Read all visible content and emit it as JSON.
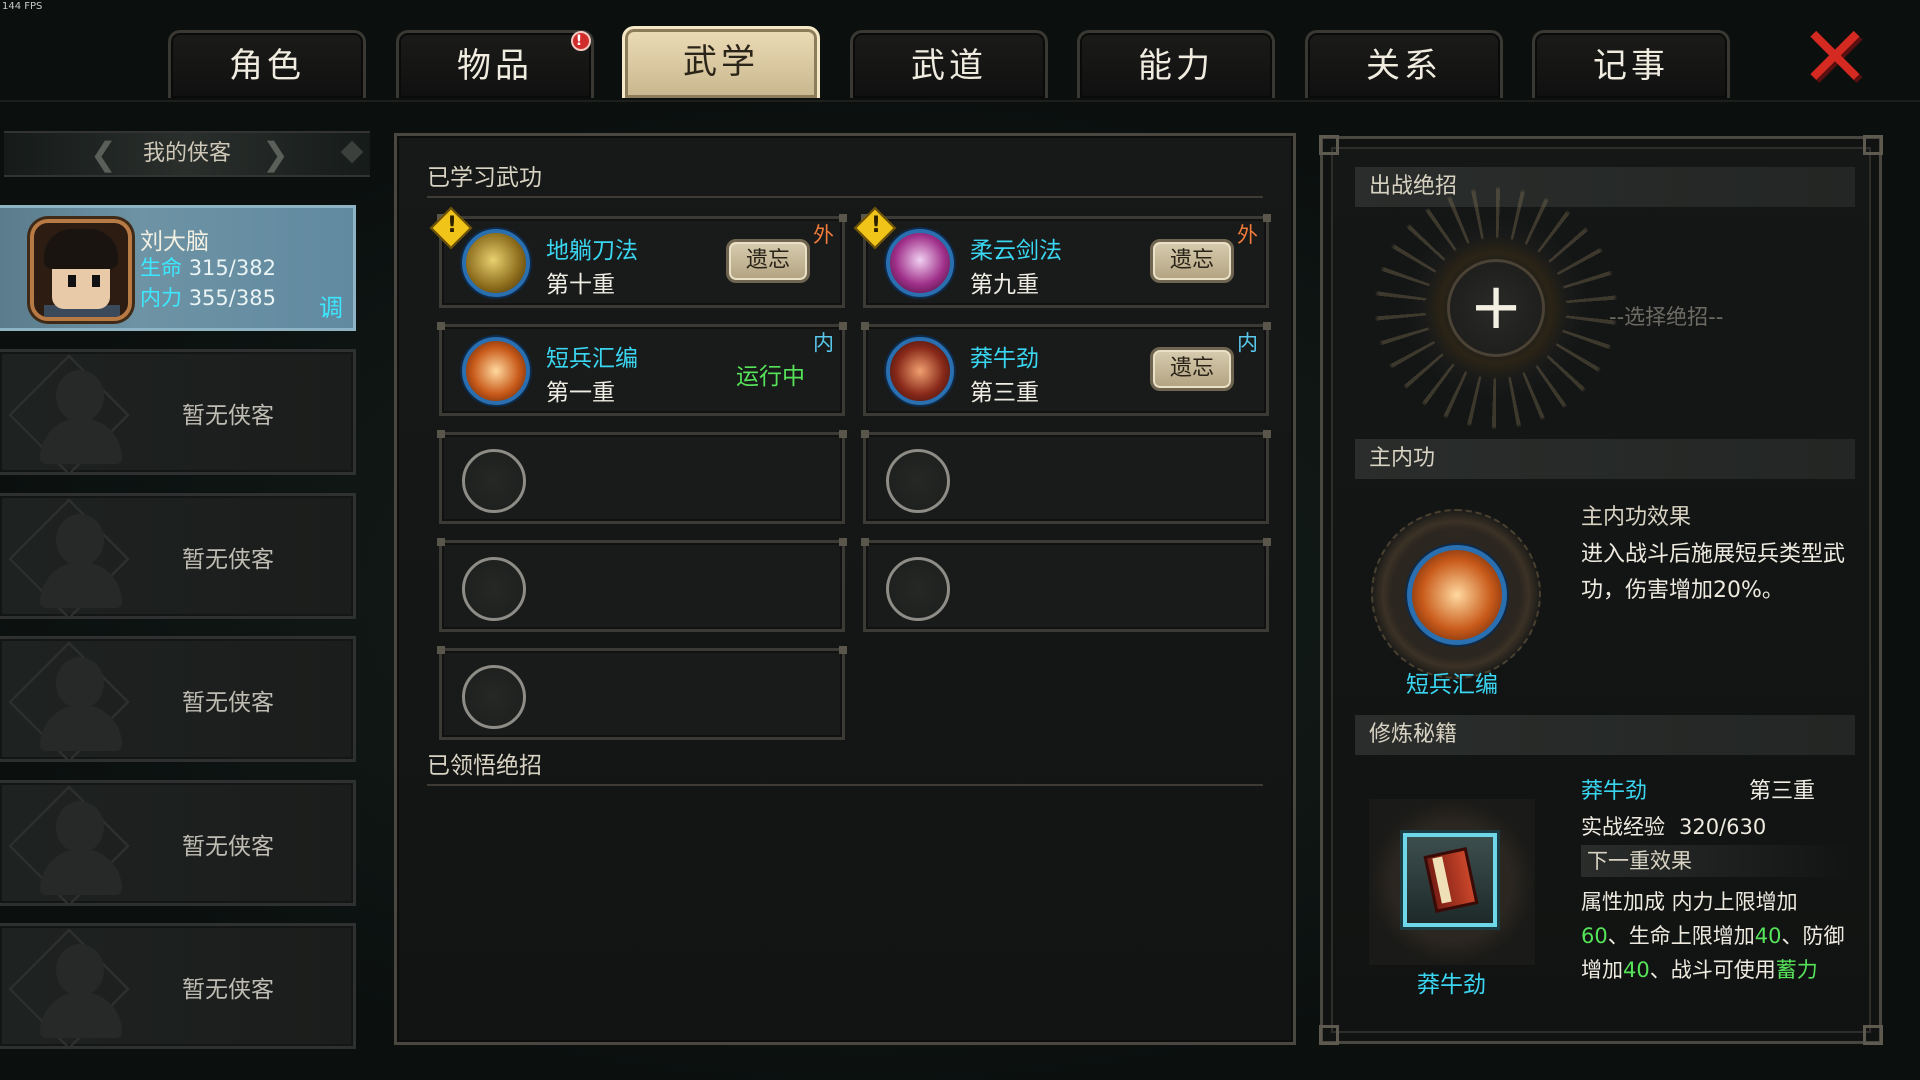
{
  "fps": "144 FPS",
  "tabs": [
    {
      "label": "角色"
    },
    {
      "label": "物品",
      "badge": "!"
    },
    {
      "label": "武学"
    },
    {
      "label": "武道"
    },
    {
      "label": "能力"
    },
    {
      "label": "关系"
    },
    {
      "label": "记事"
    }
  ],
  "active_tab": "武学",
  "roster": {
    "title": "我的侠客",
    "hero": {
      "name": "刘大脑",
      "hp_label": "生命",
      "hp": "315/382",
      "mp_label": "内力",
      "mp": "355/385",
      "tag": "调"
    },
    "empty_label": "暂无侠客"
  },
  "learned": {
    "title": "已学习武功",
    "skills": [
      {
        "name": "地躺刀法",
        "level": "第十重",
        "action": "遗忘",
        "type": "外",
        "warn": true
      },
      {
        "name": "柔云剑法",
        "level": "第九重",
        "action": "遗忘",
        "type": "外",
        "warn": true
      },
      {
        "name": "短兵汇编",
        "level": "第一重",
        "status": "运行中",
        "type": "内"
      },
      {
        "name": "莽牛劲",
        "level": "第三重",
        "action": "遗忘",
        "type": "内"
      }
    ]
  },
  "ultimates": {
    "title": "已领悟绝招"
  },
  "right": {
    "battle_ult": {
      "title": "出战绝招",
      "choose": "--选择绝招--"
    },
    "main_inner": {
      "title": "主内功",
      "skill_name": "短兵汇编",
      "effect_title": "主内功效果",
      "effect_text": "进入战斗后施展短兵类型武功，伤害增加20%。"
    },
    "training": {
      "title": "修炼秘籍",
      "book_name": "莽牛劲",
      "book_level": "第三重",
      "exp_label": "实战经验",
      "exp_value": "320/630",
      "next_label": "下一重效果",
      "next_prefix": "属性加成  内力上限增加",
      "v1": "60",
      "mid1": "、生命上限增加",
      "v2": "40",
      "mid2": "、防御增加",
      "v3": "40",
      "mid3": "、战斗可使用",
      "v4": "蓄力"
    }
  },
  "colors": {
    "accent_cyan": "#3ad5f0",
    "running_green": "#56e35a",
    "close_red": "#d42a22",
    "active_tab": "#e2d2ab"
  }
}
